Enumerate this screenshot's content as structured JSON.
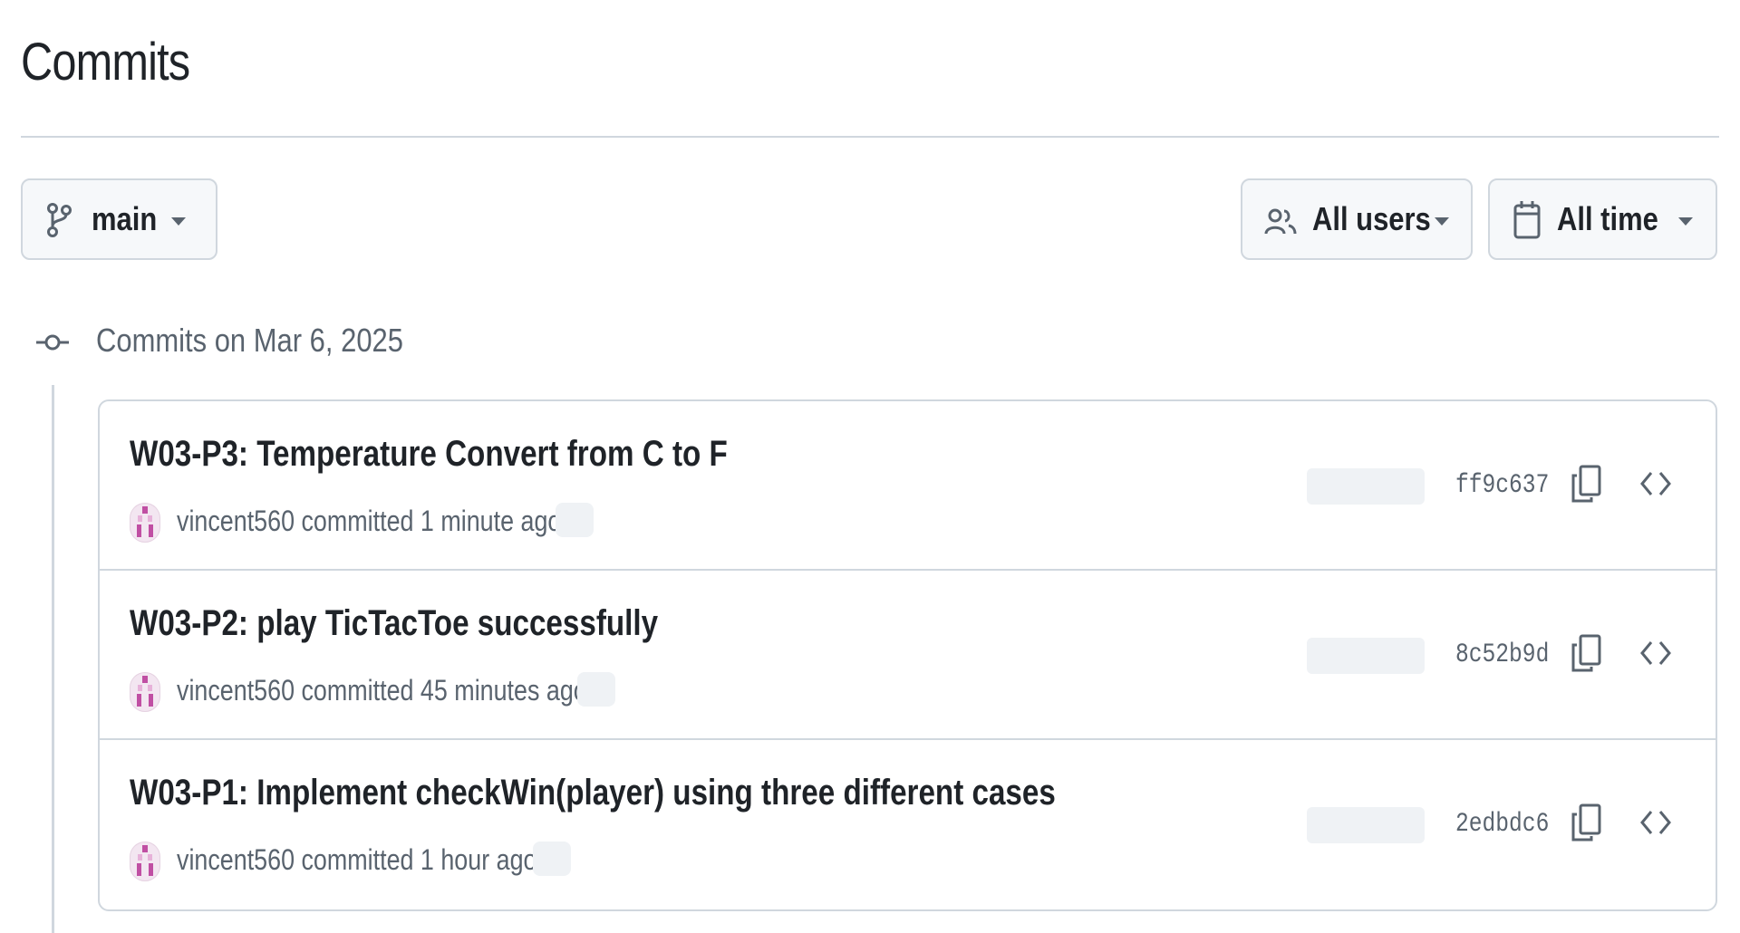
{
  "page": {
    "title": "Commits"
  },
  "filters": {
    "branch": {
      "label": "main",
      "icon": "git-branch-icon"
    },
    "users": {
      "label": "All users",
      "icon": "people-icon"
    },
    "time": {
      "label": "All time",
      "icon": "calendar-icon"
    }
  },
  "commit_group": {
    "heading": "Commits on Mar 6, 2025",
    "icon": "git-commit-icon",
    "commits": [
      {
        "title": "W03-P3: Temperature Convert from C to F",
        "author": "vincent560",
        "action": "committed",
        "time": "1 minute ago",
        "sha": "ff9c637"
      },
      {
        "title": "W03-P2: play TicTacToe successfully",
        "author": "vincent560",
        "action": "committed",
        "time": "45 minutes ago",
        "sha": "8c52b9d"
      },
      {
        "title": "W03-P1: Implement checkWin(player) using three different cases",
        "author": "vincent560",
        "action": "committed",
        "time": "1 hour ago",
        "sha": "2edbdc6"
      }
    ]
  },
  "colors": {
    "border": "#d0d7de",
    "muted_text": "#59636e",
    "avatar_accent": "#c04fa3"
  }
}
